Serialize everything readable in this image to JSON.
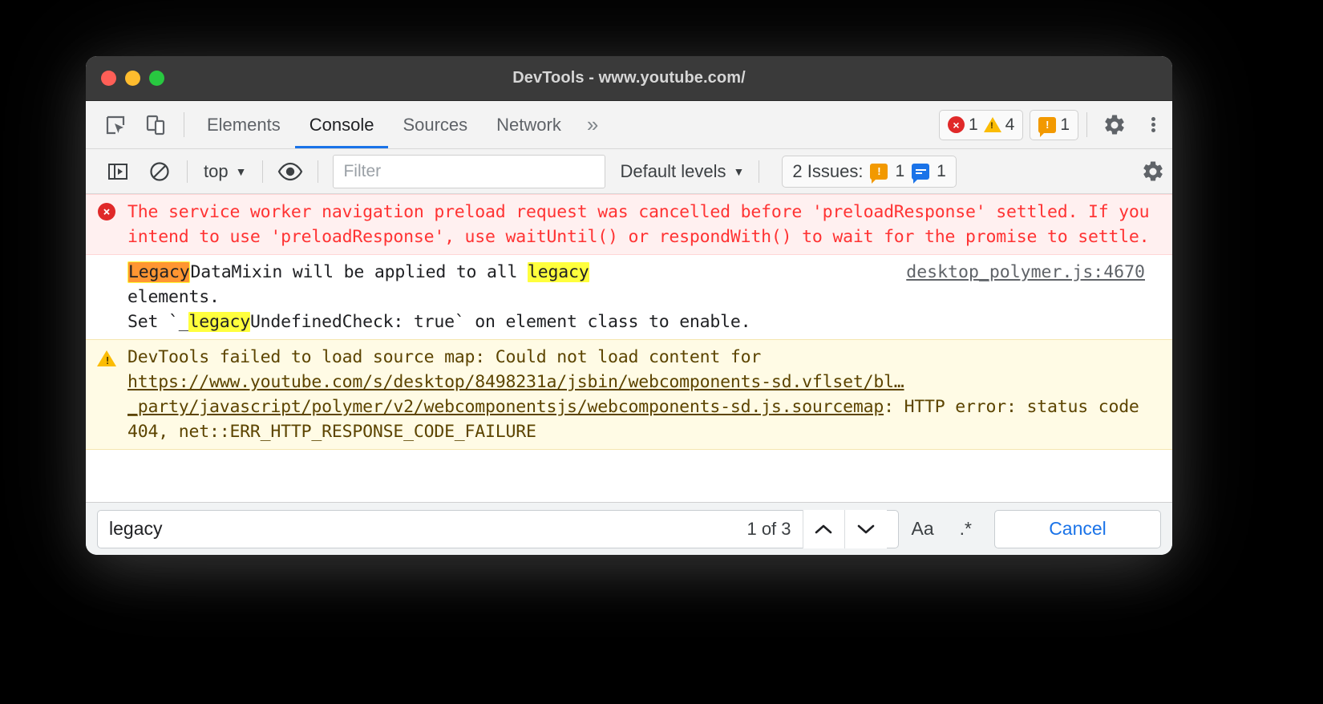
{
  "window": {
    "title": "DevTools - www.youtube.com/",
    "traffic_lights": [
      "close",
      "minimize",
      "maximize"
    ]
  },
  "tabbar": {
    "inspect_icon": "inspect-element-icon",
    "device_icon": "device-toolbar-icon",
    "tabs": [
      {
        "label": "Elements",
        "active": false
      },
      {
        "label": "Console",
        "active": true
      },
      {
        "label": "Sources",
        "active": false
      },
      {
        "label": "Network",
        "active": false
      }
    ],
    "more_tabs": "»",
    "error_count": "1",
    "warning_count": "4",
    "issue_count": "1",
    "settings_icon": "gear-icon",
    "menu_icon": "kebab-menu-icon"
  },
  "console_toolbar": {
    "sidebar_toggle_icon": "console-sidebar-icon",
    "clear_icon": "clear-console-icon",
    "context_label": "top",
    "eye_icon": "live-expression-icon",
    "filter_placeholder": "Filter",
    "filter_value": "",
    "levels_label": "Default levels",
    "issues_label": "2 Issues:",
    "issues_warning_count": "1",
    "issues_info_count": "1",
    "settings_icon": "console-settings-gear-icon"
  },
  "console_messages": {
    "error": {
      "icon": "error-circle-icon",
      "text": "The service worker navigation preload request was cancelled before 'preloadResponse' settled. If you intend to use 'preloadResponse', use waitUntil() or respondWith() to wait for the promise to settle."
    },
    "log": {
      "line1_match_active": "Legacy",
      "line1_part_a": "DataMixin will be applied to all ",
      "line1_match_2": "legacy",
      "line2": "elements.",
      "line3_prefix": "Set `_",
      "line3_match": "legacy",
      "line3_suffix": "UndefinedCheck: true` on element class to enable.",
      "source_link": "desktop_polymer.js:4670"
    },
    "warning": {
      "icon": "warning-triangle-icon",
      "prefix": "DevTools failed to load source map: Could not load content for ",
      "url": "https://www.youtube.com/s/desktop/8498231a/jsbin/webcomponents-sd.vflset/bl…_party/javascript/polymer/v2/webcomponentsjs/webcomponents-sd.js.sourcemap",
      "suffix": ": HTTP error: status code 404, net::ERR_HTTP_RESPONSE_CODE_FAILURE"
    }
  },
  "searchbar": {
    "query": "legacy",
    "placeholder": "Find",
    "match_count": "1 of 3",
    "prev_icon": "chevron-up-icon",
    "next_icon": "chevron-down-icon",
    "match_case_label": "Aa",
    "regex_label": ".*",
    "cancel_label": "Cancel"
  },
  "colors": {
    "accent": "#1a73e8",
    "error": "#ff3333",
    "error_bg": "#fff0f0",
    "warning_bg": "#fffbe5",
    "warning_text": "#5c4400",
    "highlight": "#ffff3d",
    "highlight_active": "#ff9632",
    "titlebar": "#3a3a3a"
  }
}
